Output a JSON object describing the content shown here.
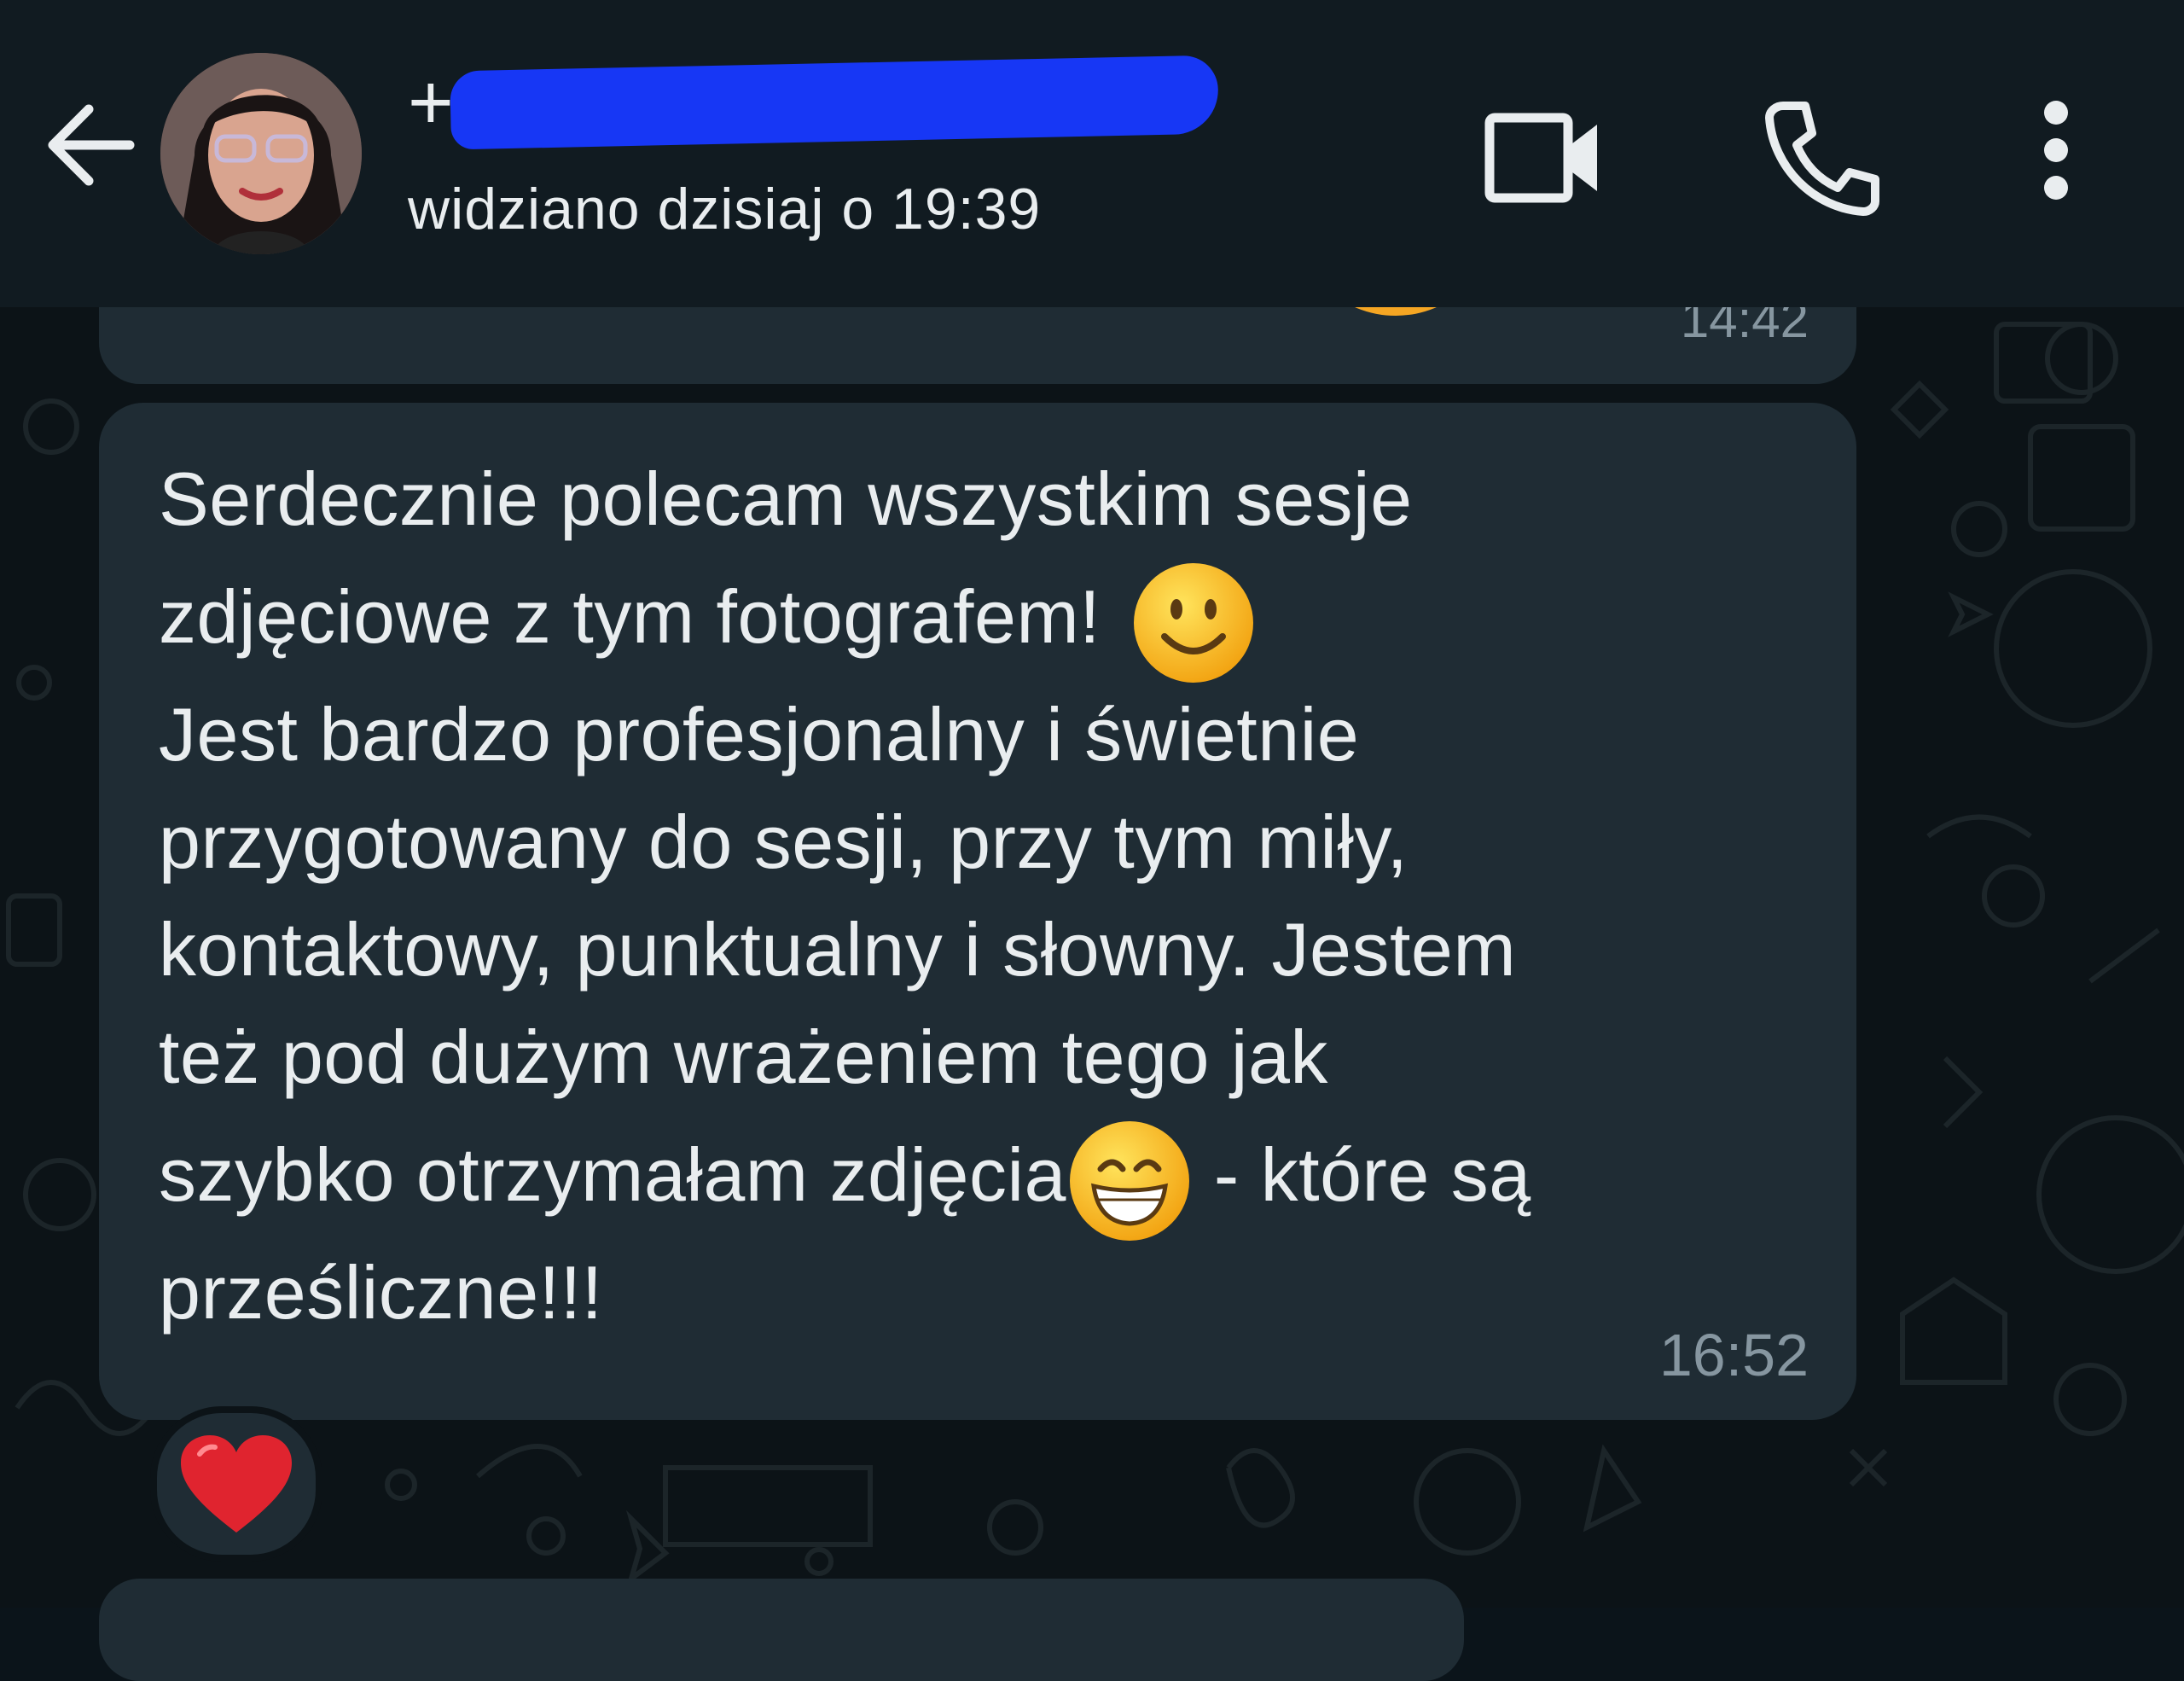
{
  "header": {
    "contact_prefix": "+",
    "last_seen": "widziano dzisiaj o 19:39",
    "icons": {
      "back": "arrow-left-icon",
      "video": "video-camera-icon",
      "call": "phone-icon",
      "menu": "more-vertical-icon"
    }
  },
  "messages": {
    "previous": {
      "time": "14:42"
    },
    "current": {
      "lines": [
        "Serdecznie polecam wszystkim sesje",
        "zdjęciowe z tym fotografem! ",
        "Jest bardzo profesjonalny i świetnie",
        "przygotowany do sesji, przy tym miły,",
        "kontaktowy, punktualny i słowny. Jestem",
        "też pod dużym wrażeniem tego jak",
        "szybko otrzymałam zdjęcia",
        " - które są",
        "prześliczne!!!"
      ],
      "time": "16:52",
      "reaction": "❤️"
    }
  },
  "colors": {
    "header_bg": "#111b21",
    "chat_bg": "#0c1317",
    "bubble_bg": "#1f2c34",
    "text": "#e9edef",
    "meta": "#8696a0"
  }
}
